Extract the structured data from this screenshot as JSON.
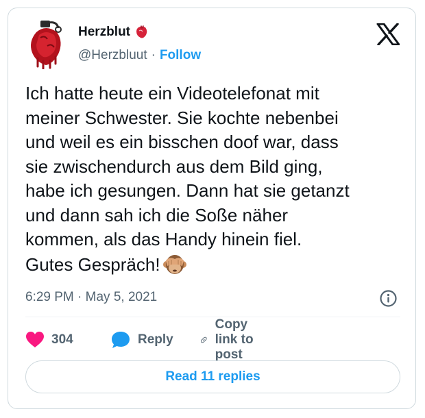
{
  "author": {
    "display_name": "Herzblut",
    "handle": "@Herzbluut",
    "separator": "·",
    "follow_label": "Follow"
  },
  "tweet": {
    "text": "Ich hatte heute ein Videotelefonat mit\nmeiner Schwester. Sie kochte nebenbei\nund weil es ein bisschen doof war, dass\nsie zwischendurch aus dem Bild ging,\nhabe ich gesungen. Dann hat sie getanzt\nund dann sah ich die Soße näher\nkommen, als das Handy hinein fiel.\nGutes Gespräch!",
    "timestamp": "6:29 PM · May 5, 2021"
  },
  "actions": {
    "like_count": "304",
    "reply_label": "Reply",
    "copy_link_label": "Copy link to post"
  },
  "footer": {
    "read_replies_label": "Read 11 replies"
  },
  "icons": {
    "avatar": "anatomical-heart-grenade-avatar",
    "name_badge": "anatomical-heart-icon",
    "logo": "x-logo-icon",
    "emoji": "see-no-evil-monkey-icon",
    "info": "info-icon",
    "like": "heart-icon",
    "reply": "speech-bubble-icon",
    "copy": "link-icon"
  },
  "colors": {
    "accent": "#1d9bf0",
    "like": "#f91880",
    "secondary_text": "#536471",
    "border": "#cfd9de"
  }
}
